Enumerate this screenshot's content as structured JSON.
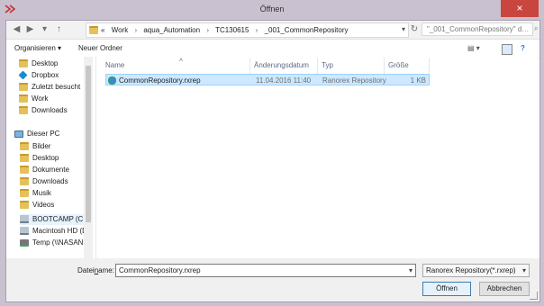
{
  "window": {
    "title": "Öffnen",
    "close": "×"
  },
  "address": {
    "crumbs": [
      "«",
      "Work",
      "›",
      "aqua_Automation",
      "›",
      "TC130615",
      "›",
      "_001_CommonRepository"
    ],
    "search": "\"_001_CommonRepository\" d…"
  },
  "toolbar": {
    "organize": "Organisieren ▾",
    "new_folder": "Neuer Ordner"
  },
  "sidebar": {
    "items": [
      {
        "label": "Desktop",
        "icon": "desktop-folder-icon"
      },
      {
        "label": "Dropbox",
        "icon": "dropbox-icon"
      },
      {
        "label": "Zuletzt besucht",
        "icon": "recent-folder-icon"
      },
      {
        "label": "Work",
        "icon": "folder-icon"
      },
      {
        "label": "Downloads",
        "icon": "downloads-folder-icon"
      },
      {
        "label": "Dieser PC",
        "icon": "computer-icon"
      },
      {
        "label": "Bilder",
        "icon": "pictures-folder-icon"
      },
      {
        "label": "Desktop",
        "icon": "desktop-folder-icon"
      },
      {
        "label": "Dokumente",
        "icon": "documents-folder-icon"
      },
      {
        "label": "Downloads",
        "icon": "downloads-folder-icon"
      },
      {
        "label": "Musik",
        "icon": "music-folder-icon"
      },
      {
        "label": "Videos",
        "icon": "videos-folder-icon"
      },
      {
        "label": "BOOTCAMP (C:)",
        "icon": "drive-icon"
      },
      {
        "label": "Macintosh HD (D",
        "icon": "drive-icon"
      },
      {
        "label": "Temp (\\\\NASAN",
        "icon": "network-drive-icon"
      }
    ]
  },
  "list": {
    "columns": [
      "Name",
      "Änderungsdatum",
      "Typ",
      "Größe"
    ],
    "rows": [
      {
        "name": "CommonRepository.rxrep",
        "date": "11.04.2016 11:40",
        "type": "Ranorex Repository",
        "size": "1 KB"
      }
    ]
  },
  "footer": {
    "filename_label_prefix": "Datei",
    "filename_label_underline": "n",
    "filename_label_suffix": "ame:",
    "filename_value": "CommonRepository.rxrep",
    "filter_value": "Ranorex Repository(*.rxrep)",
    "open": "Öffnen",
    "cancel": "Abbrechen"
  },
  "colors": {
    "selected_row": "#cde8ff",
    "close_button": "#c9463e"
  }
}
